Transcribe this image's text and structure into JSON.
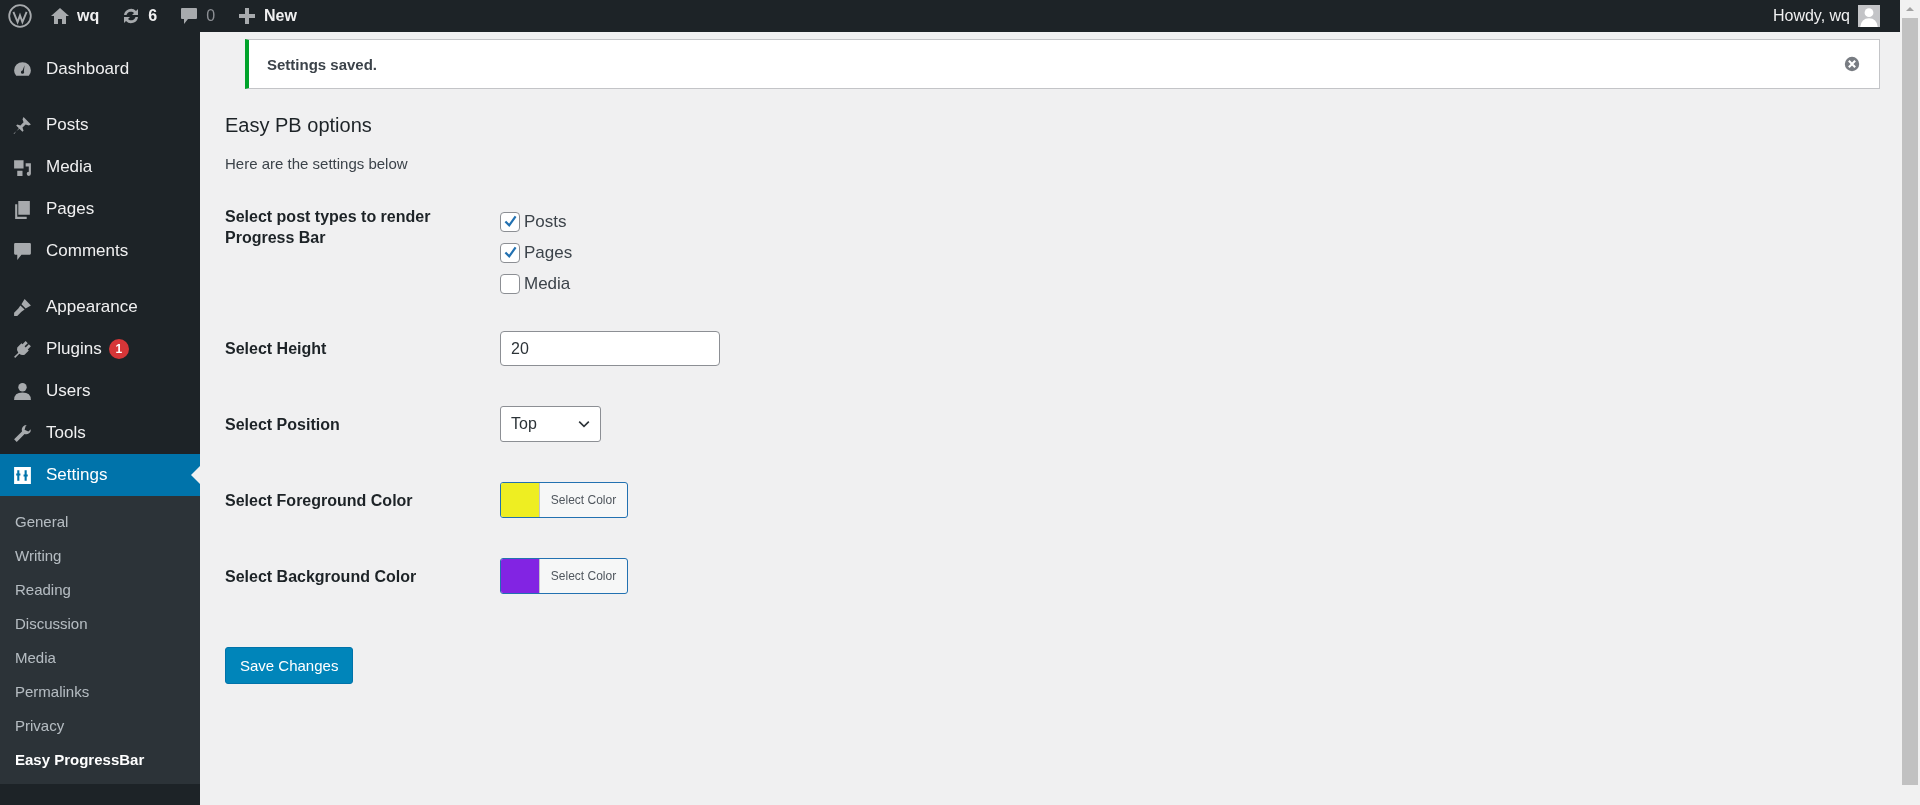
{
  "admin_bar": {
    "site_name": "wq",
    "updates_count": "6",
    "comments_count": "0",
    "new_label": "New",
    "greeting": "Howdy, wq"
  },
  "sidebar": {
    "groups": [
      [
        {
          "label": "Dashboard",
          "selected": false
        }
      ],
      [
        {
          "label": "Posts",
          "selected": false
        },
        {
          "label": "Media",
          "selected": false
        },
        {
          "label": "Pages",
          "selected": false
        },
        {
          "label": "Comments",
          "selected": false
        }
      ],
      [
        {
          "label": "Appearance",
          "selected": false
        },
        {
          "label": "Plugins",
          "selected": false,
          "badge": "1"
        },
        {
          "label": "Users",
          "selected": false
        },
        {
          "label": "Tools",
          "selected": false
        },
        {
          "label": "Settings",
          "selected": true,
          "children": [
            {
              "label": "General",
              "selected": false
            },
            {
              "label": "Writing",
              "selected": false
            },
            {
              "label": "Reading",
              "selected": false
            },
            {
              "label": "Discussion",
              "selected": false
            },
            {
              "label": "Media",
              "selected": false
            },
            {
              "label": "Permalinks",
              "selected": false
            },
            {
              "label": "Privacy",
              "selected": false
            },
            {
              "label": "Easy ProgressBar",
              "selected": true
            }
          ]
        }
      ]
    ]
  },
  "notice": {
    "message": "Settings saved."
  },
  "page": {
    "title": "Easy PB options",
    "description": "Here are the settings below",
    "fields": [
      {
        "kind": "checkboxes",
        "label": "Select post types to render Progress Bar",
        "options": [
          {
            "label": "Posts",
            "checked": true
          },
          {
            "label": "Pages",
            "checked": true
          },
          {
            "label": "Media",
            "checked": false
          }
        ]
      },
      {
        "kind": "text",
        "label": "Select Height",
        "value": "20"
      },
      {
        "kind": "select",
        "label": "Select Position",
        "value": "Top"
      },
      {
        "kind": "color",
        "label": "Select Foreground Color",
        "color": "#eeee22",
        "button_label": "Select Color"
      },
      {
        "kind": "color",
        "label": "Select Background Color",
        "color": "#8224e3",
        "button_label": "Select Color"
      }
    ],
    "save_label": "Save Changes"
  }
}
